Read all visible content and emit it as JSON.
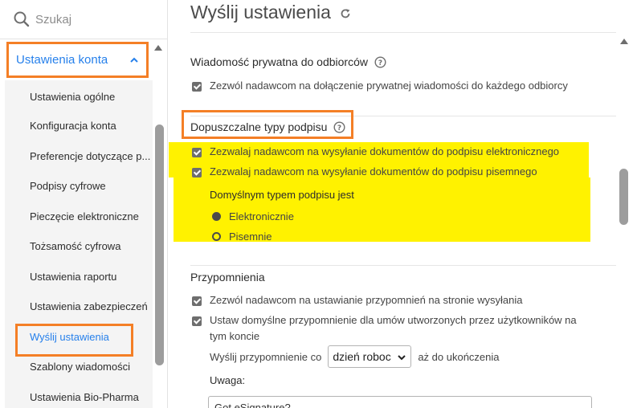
{
  "sidebar": {
    "search_placeholder": "Szukaj",
    "section_label": "Ustawienia konta",
    "items": [
      {
        "label": "Ustawienia ogólne"
      },
      {
        "label": "Konfiguracja konta"
      },
      {
        "label": "Preferencje dotyczące p..."
      },
      {
        "label": "Podpisy cyfrowe"
      },
      {
        "label": "Pieczęcie elektroniczne"
      },
      {
        "label": "Tożsamość cyfrowa"
      },
      {
        "label": "Ustawienia raportu"
      },
      {
        "label": "Ustawienia zabezpieczeń"
      },
      {
        "label": "Wyślij ustawienia"
      },
      {
        "label": "Szablony wiadomości"
      },
      {
        "label": "Ustawienia Bio-Pharma"
      }
    ],
    "active_item": "Wyślij ustawienia"
  },
  "main": {
    "title": "Wyślij ustawienia",
    "private_message": {
      "title": "Wiadomość prywatna do odbiorców",
      "option": "Zezwól nadawcom na dołączenie prywatnej wiadomości do każdego odbiorcy"
    },
    "signature_types": {
      "title": "Dopuszczalne typy podpisu",
      "option_electronic": "Zezwalaj nadawcom na wysyłanie dokumentów do podpisu elektronicznego",
      "option_written": "Zezwalaj nadawcom na wysyłanie dokumentów do podpisu pisemnego",
      "default_label": "Domyślnym typem podpisu jest",
      "radio_electronic": "Elektronicznie",
      "radio_written": "Pisemnie",
      "selected": "Elektronicznie"
    },
    "reminders": {
      "title": "Przypomnienia",
      "option_sending_page": "Zezwól nadawcom na ustawianie przypomnień na stronie wysyłania",
      "option_default": "Ustaw domyślne przypomnienie dla umów utworzonych przez użytkowników na tym koncie",
      "interval_prefix": "Wyślij przypomnienie co",
      "interval_value": "dzień roboc",
      "interval_suffix": "aż do ukończenia",
      "note_label": "Uwaga:",
      "note_value": "Got eSignature?"
    }
  },
  "colors": {
    "accent_blue": "#2680eb",
    "highlight_orange": "#f47f26",
    "highlight_yellow": "#fff200"
  },
  "icons": {
    "search": "search-icon",
    "chevron_up": "chevron-up-icon",
    "refresh": "refresh-icon",
    "help": "help-icon",
    "dropdown": "chevron-down-icon"
  }
}
